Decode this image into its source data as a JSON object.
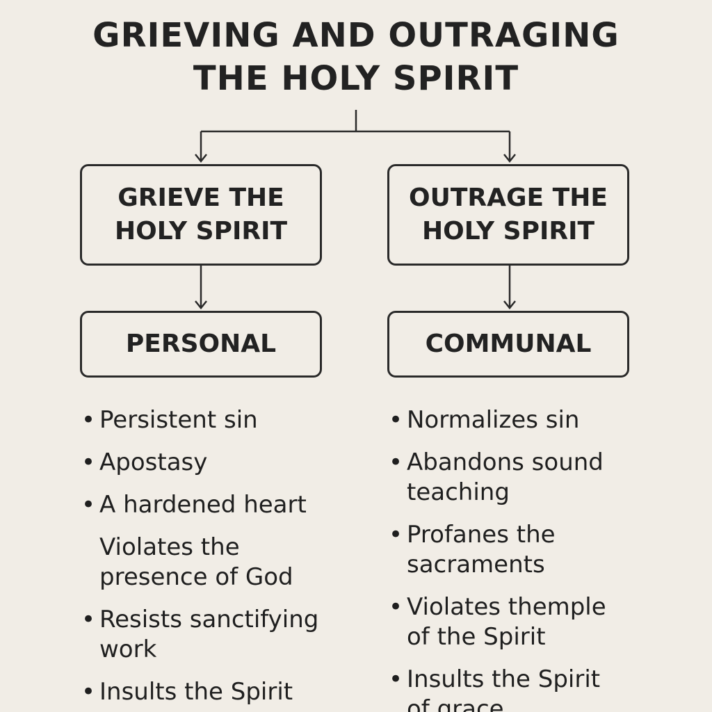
{
  "title": {
    "line1": "GRIEVING AND OUTRAGING",
    "line2": "THE HOLY SPIRIT"
  },
  "left": {
    "box_top": {
      "line1": "GRIEVE THE",
      "line2": "HOLY SPIRIT"
    },
    "box_bottom": "PERSONAL",
    "items": [
      {
        "bullet": "•",
        "text": "Persistent sin"
      },
      {
        "bullet": "•",
        "text": "Apostasy"
      },
      {
        "bullet": "•",
        "text": "A hardened heart"
      },
      {
        "bullet": "",
        "text": "Violates the presence of God"
      },
      {
        "bullet": "•",
        "text": "Resists sanctifying work"
      },
      {
        "bullet": "•",
        "text": "Insults the Spirit"
      }
    ]
  },
  "right": {
    "box_top": {
      "line1": "OUTRAGE THE",
      "line2": "HOLY SPIRIT"
    },
    "box_bottom": "COMMUNAL",
    "items": [
      {
        "bullet": "•",
        "text": "Normalizes sin"
      },
      {
        "bullet": "•",
        "text": "Abandons sound teaching"
      },
      {
        "bullet": "•",
        "text": "Profanes the sacraments"
      },
      {
        "bullet": "•",
        "text": "Violates themple of the Spirit"
      },
      {
        "bullet": "•",
        "text": "Insults the Spirit of grace"
      }
    ]
  }
}
